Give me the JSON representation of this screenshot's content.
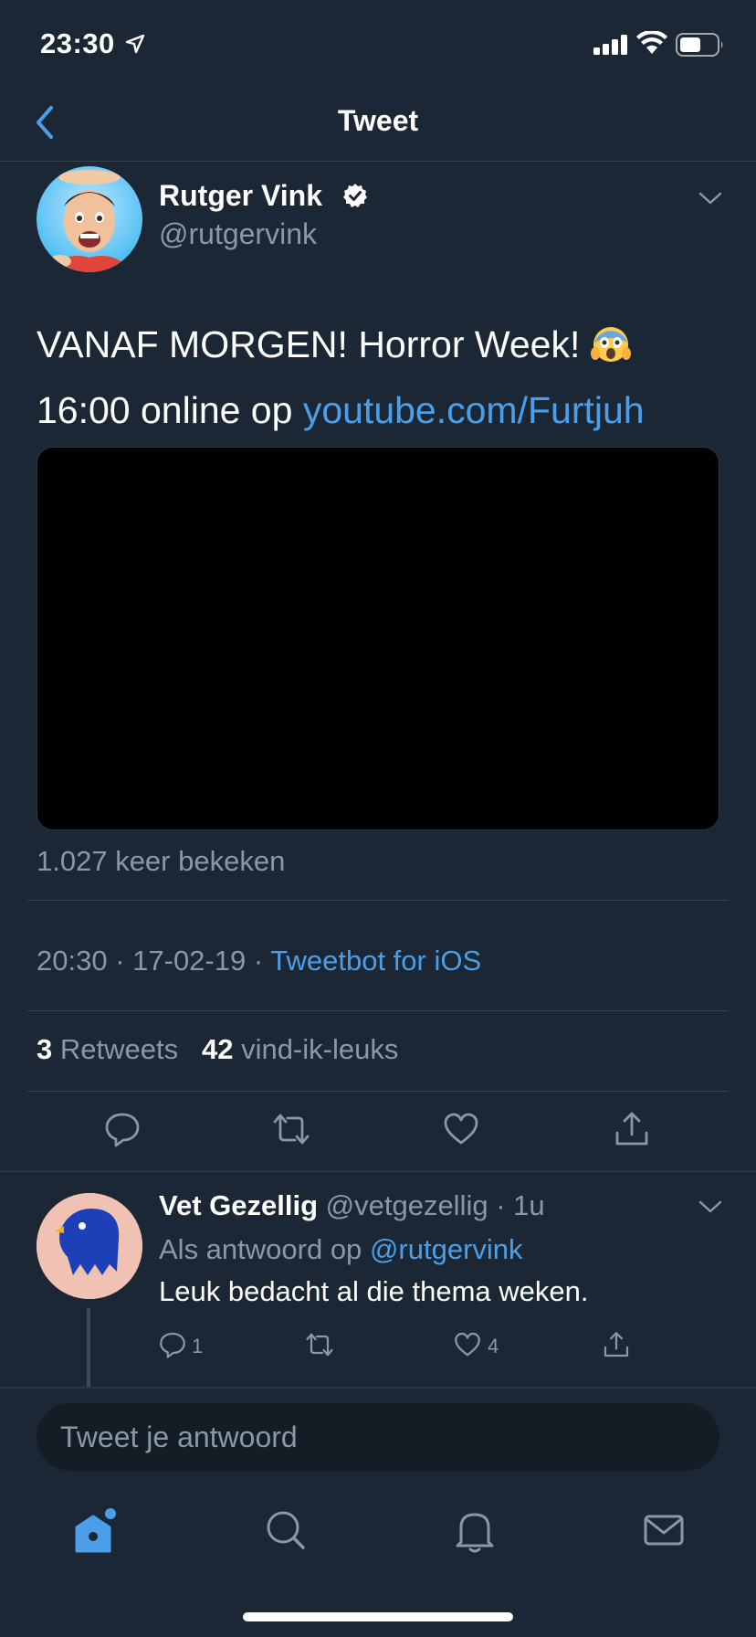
{
  "status_bar": {
    "time": "23:30",
    "icons": [
      "location-arrow-icon",
      "signal-icon",
      "wifi-icon",
      "battery-icon"
    ]
  },
  "nav": {
    "title": "Tweet",
    "back_icon": "chevron-left-icon"
  },
  "tweet": {
    "author_name": "Rutger Vink",
    "author_handle": "@rutgervink",
    "verified": true,
    "text_line1": "VANAF MORGEN! Horror Week!",
    "emoji": "😱",
    "text_line2_prefix": "16:00 online op",
    "link": "youtube.com/Furtjuh",
    "views": "1.027 keer bekeken",
    "time": "20:30",
    "date": "17-02-19",
    "client": "Tweetbot for iOS",
    "retweet_count": "3",
    "retweet_label": "Retweets",
    "like_count": "42",
    "like_label": "vind-ik-leuks"
  },
  "reply": {
    "name": "Vet Gezellig",
    "handle": "@vetgezellig",
    "time": "1u",
    "context_prefix": "Als antwoord op",
    "context_handle": "@rutgervink",
    "text": "Leuk bedacht al die thema weken.",
    "reply_count": "1",
    "like_count": "4",
    "avatar_text": "Vet Gezellig"
  },
  "compose": {
    "placeholder": "Tweet je antwoord"
  },
  "tabs": [
    "home-icon",
    "search-icon",
    "notifications-icon",
    "messages-icon"
  ],
  "colors": {
    "background": "#1c2736",
    "accent": "#4a9fe8",
    "secondary_text": "#8899a6",
    "divider": "#38444d"
  }
}
